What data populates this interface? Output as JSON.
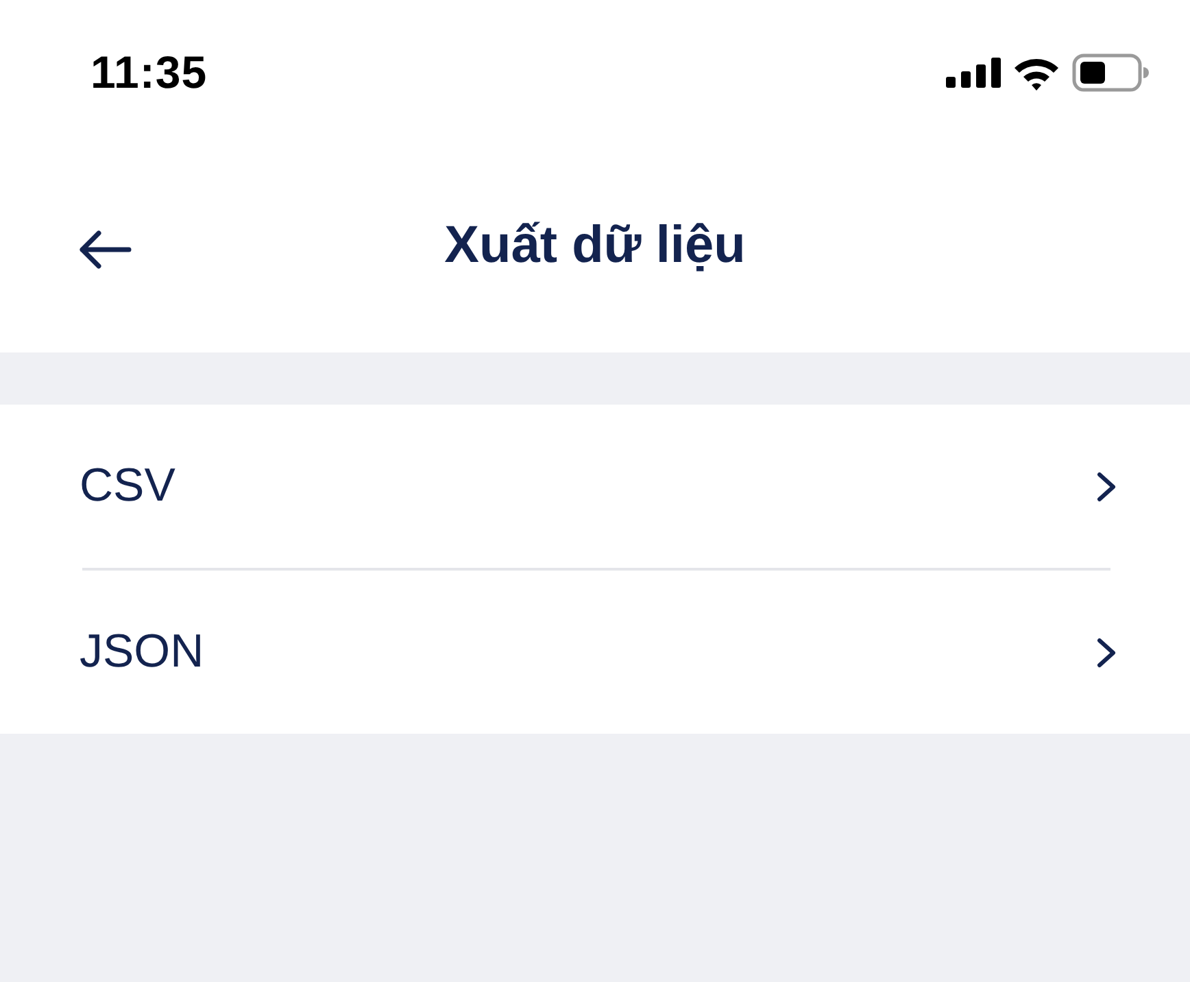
{
  "status_bar": {
    "time": "11:35"
  },
  "nav_bar": {
    "title": "Xuất dữ liệu"
  },
  "items": [
    {
      "label": "CSV"
    },
    {
      "label": "JSON"
    }
  ]
}
